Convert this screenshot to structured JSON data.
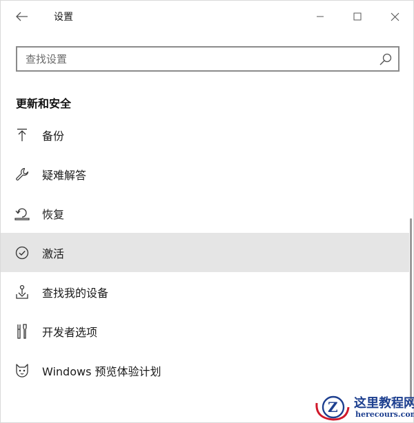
{
  "window": {
    "title": "设置"
  },
  "search": {
    "placeholder": "查找设置",
    "value": ""
  },
  "section": {
    "title": "更新和安全"
  },
  "nav": {
    "items": [
      {
        "label": "备份",
        "icon": "backup-arrow-icon"
      },
      {
        "label": "疑难解答",
        "icon": "wrench-icon"
      },
      {
        "label": "恢复",
        "icon": "recovery-icon"
      },
      {
        "label": "激活",
        "icon": "check-circle-icon",
        "selected": true
      },
      {
        "label": "查找我的设备",
        "icon": "find-device-icon"
      },
      {
        "label": "开发者选项",
        "icon": "developer-tools-icon"
      },
      {
        "label": "Windows 预览体验计划",
        "icon": "insider-cat-icon"
      }
    ]
  },
  "watermark": {
    "title": "这里教程网",
    "url": "herecours.com"
  },
  "colors": {
    "selected_bg": "#e5e5e5",
    "search_border": "#8a8a8a",
    "watermark": "#1d3f8f",
    "watermark_accent": "#d0182a"
  }
}
